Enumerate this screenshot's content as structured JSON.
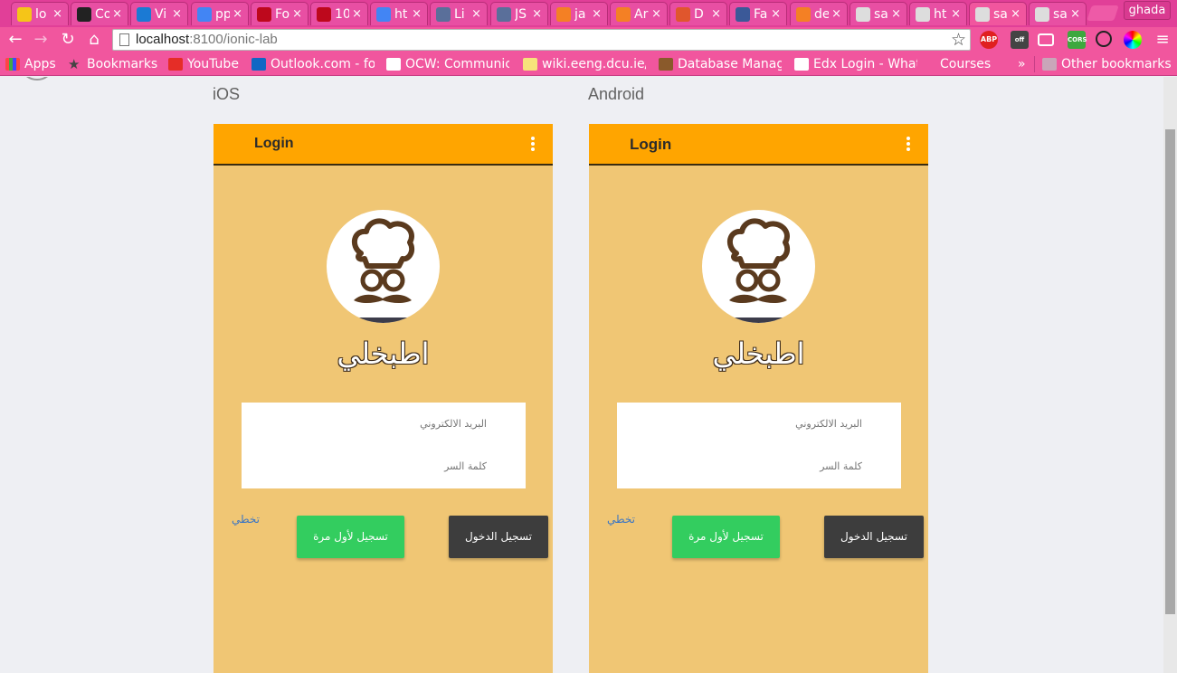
{
  "browser": {
    "tabs": [
      {
        "label": "lo",
        "color": "#f5c518"
      },
      {
        "label": "Co",
        "color": "#222222"
      },
      {
        "label": "Vi",
        "color": "#1b7ad4"
      },
      {
        "label": "pp",
        "color": "#4285f4"
      },
      {
        "label": "Fo",
        "color": "#bd081c"
      },
      {
        "label": "10",
        "color": "#bd081c"
      },
      {
        "label": "ht",
        "color": "#4285f4"
      },
      {
        "label": "Li",
        "color": "#5a6f9a"
      },
      {
        "label": "JS",
        "color": "#5a6f9a"
      },
      {
        "label": "ja",
        "color": "#f48024"
      },
      {
        "label": "Ar",
        "color": "#f48024"
      },
      {
        "label": "D",
        "color": "#e0562d"
      },
      {
        "label": "Fa",
        "color": "#3b5998"
      },
      {
        "label": "de",
        "color": "#f48024"
      },
      {
        "label": "sa",
        "color": "#dddddd"
      },
      {
        "label": "ht",
        "color": "#dddddd"
      },
      {
        "label": "sa",
        "color": "#dddddd"
      },
      {
        "label": "sa",
        "color": "#dddddd"
      }
    ],
    "profile_name": "ghada",
    "url_host": "localhost",
    "url_rest": ":8100/ionic-lab",
    "extensions": [
      "ABP",
      "off",
      "",
      "CORS",
      "",
      ""
    ],
    "bookmarks": [
      {
        "label": "Apps"
      },
      {
        "label": "Bookmarks"
      },
      {
        "label": "YouTube"
      },
      {
        "label": "Outlook.com - fo"
      },
      {
        "label": "OCW: Communic"
      },
      {
        "label": "wiki.eeng.dcu.ie/"
      },
      {
        "label": "Database Manag"
      },
      {
        "label": "Edx Login - What"
      },
      {
        "label": "Courses"
      },
      {
        "label": "»"
      },
      {
        "label": "Other bookmarks"
      }
    ]
  },
  "lab": {
    "ios_label": "iOS",
    "android_label": "Android",
    "header_title": "Login",
    "app_name": "اطبخلي",
    "email_placeholder": "البريد الالكتروني",
    "password_placeholder": "كلمة السر",
    "skip_label": "تخطي",
    "signup_label": "تسجيل لأول مرة",
    "login_label": "تسجيل الدخول"
  }
}
